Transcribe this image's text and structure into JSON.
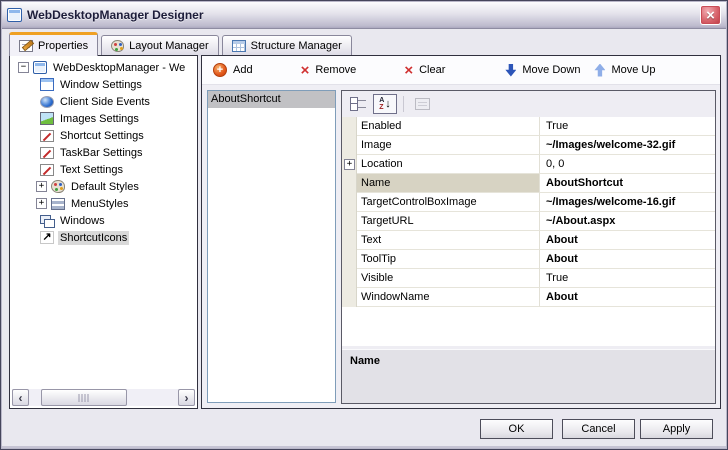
{
  "window": {
    "title": "WebDesktopManager Designer",
    "close_icon": "close-x"
  },
  "tabs": [
    {
      "label": "Properties",
      "icon": "properties-form-icon",
      "active": true
    },
    {
      "label": "Layout Manager",
      "icon": "palette-icon",
      "active": false
    },
    {
      "label": "Structure Manager",
      "icon": "table-grid-icon",
      "active": false
    }
  ],
  "tree": {
    "root": {
      "label": "WebDesktopManager - We",
      "icon": "app-window-icon",
      "expanded": true
    },
    "items": [
      {
        "label": "Window Settings",
        "icon": "window-icon"
      },
      {
        "label": "Client Side Events",
        "icon": "events-sphere-icon"
      },
      {
        "label": "Images Settings",
        "icon": "image-icon"
      },
      {
        "label": "Shortcut Settings",
        "icon": "form-edit-icon"
      },
      {
        "label": "TaskBar Settings",
        "icon": "form-edit-icon"
      },
      {
        "label": "Text Settings",
        "icon": "form-edit-icon"
      },
      {
        "label": "Default Styles",
        "icon": "palette-icon",
        "expandable": true
      },
      {
        "label": "MenuStyles",
        "icon": "menu-styles-icon",
        "expandable": true
      },
      {
        "label": "Windows",
        "icon": "cascade-windows-icon"
      },
      {
        "label": "ShortcutIcons",
        "icon": "shortcut-arrow-icon",
        "selected": true
      }
    ]
  },
  "toolbar": {
    "add": "Add",
    "remove": "Remove",
    "clear": "Clear",
    "move_down": "Move Down",
    "move_up": "Move Up"
  },
  "shortcut_list": {
    "items": [
      {
        "label": "AboutShortcut",
        "selected": true
      }
    ]
  },
  "property_grid": {
    "toolbar": {
      "categorized_icon": "categorized-icon",
      "alphabetical_icon": "az-sort-icon",
      "property_pages_icon": "property-pages-icon",
      "sort_mode": "alphabetical"
    },
    "rows": [
      {
        "name": "Enabled",
        "value": "True",
        "bold": false
      },
      {
        "name": "Image",
        "value": "~/Images/welcome-32.gif",
        "bold": true
      },
      {
        "name": "Location",
        "value": "0, 0",
        "bold": false,
        "expandable": true
      },
      {
        "name": "Name",
        "value": "AboutShortcut",
        "bold": true,
        "selected": true
      },
      {
        "name": "TargetControlBoxImage",
        "value": "~/Images/welcome-16.gif",
        "bold": true
      },
      {
        "name": "TargetURL",
        "value": "~/About.aspx",
        "bold": true
      },
      {
        "name": "Text",
        "value": "About",
        "bold": true
      },
      {
        "name": "ToolTip",
        "value": "About",
        "bold": true
      },
      {
        "name": "Visible",
        "value": "True",
        "bold": false
      },
      {
        "name": "WindowName",
        "value": "About",
        "bold": true
      }
    ],
    "description": {
      "title": "Name"
    }
  },
  "footer": {
    "ok": "OK",
    "cancel": "Cancel",
    "apply": "Apply"
  },
  "colors": {
    "active_tab_accent": "#EFA023",
    "close_button_red": "#D8636B",
    "selected_row_tan": "#D7D3C3",
    "list_selection_gray": "#C1C1C4",
    "titlebar_silver": "#BDBACD"
  }
}
